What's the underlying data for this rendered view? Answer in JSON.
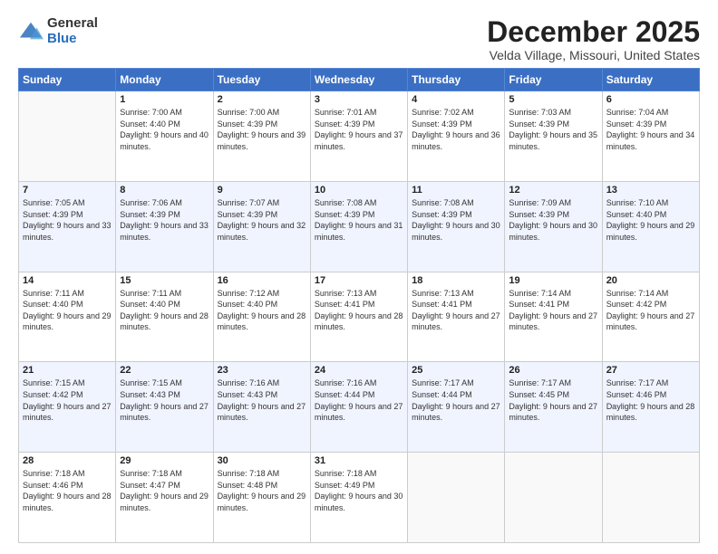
{
  "logo": {
    "general": "General",
    "blue": "Blue"
  },
  "title": "December 2025",
  "subtitle": "Velda Village, Missouri, United States",
  "days_of_week": [
    "Sunday",
    "Monday",
    "Tuesday",
    "Wednesday",
    "Thursday",
    "Friday",
    "Saturday"
  ],
  "weeks": [
    [
      {
        "day": "",
        "sunrise": "",
        "sunset": "",
        "daylight": ""
      },
      {
        "day": "1",
        "sunrise": "Sunrise: 7:00 AM",
        "sunset": "Sunset: 4:40 PM",
        "daylight": "Daylight: 9 hours and 40 minutes."
      },
      {
        "day": "2",
        "sunrise": "Sunrise: 7:00 AM",
        "sunset": "Sunset: 4:39 PM",
        "daylight": "Daylight: 9 hours and 39 minutes."
      },
      {
        "day": "3",
        "sunrise": "Sunrise: 7:01 AM",
        "sunset": "Sunset: 4:39 PM",
        "daylight": "Daylight: 9 hours and 37 minutes."
      },
      {
        "day": "4",
        "sunrise": "Sunrise: 7:02 AM",
        "sunset": "Sunset: 4:39 PM",
        "daylight": "Daylight: 9 hours and 36 minutes."
      },
      {
        "day": "5",
        "sunrise": "Sunrise: 7:03 AM",
        "sunset": "Sunset: 4:39 PM",
        "daylight": "Daylight: 9 hours and 35 minutes."
      },
      {
        "day": "6",
        "sunrise": "Sunrise: 7:04 AM",
        "sunset": "Sunset: 4:39 PM",
        "daylight": "Daylight: 9 hours and 34 minutes."
      }
    ],
    [
      {
        "day": "7",
        "sunrise": "Sunrise: 7:05 AM",
        "sunset": "Sunset: 4:39 PM",
        "daylight": "Daylight: 9 hours and 33 minutes."
      },
      {
        "day": "8",
        "sunrise": "Sunrise: 7:06 AM",
        "sunset": "Sunset: 4:39 PM",
        "daylight": "Daylight: 9 hours and 33 minutes."
      },
      {
        "day": "9",
        "sunrise": "Sunrise: 7:07 AM",
        "sunset": "Sunset: 4:39 PM",
        "daylight": "Daylight: 9 hours and 32 minutes."
      },
      {
        "day": "10",
        "sunrise": "Sunrise: 7:08 AM",
        "sunset": "Sunset: 4:39 PM",
        "daylight": "Daylight: 9 hours and 31 minutes."
      },
      {
        "day": "11",
        "sunrise": "Sunrise: 7:08 AM",
        "sunset": "Sunset: 4:39 PM",
        "daylight": "Daylight: 9 hours and 30 minutes."
      },
      {
        "day": "12",
        "sunrise": "Sunrise: 7:09 AM",
        "sunset": "Sunset: 4:39 PM",
        "daylight": "Daylight: 9 hours and 30 minutes."
      },
      {
        "day": "13",
        "sunrise": "Sunrise: 7:10 AM",
        "sunset": "Sunset: 4:40 PM",
        "daylight": "Daylight: 9 hours and 29 minutes."
      }
    ],
    [
      {
        "day": "14",
        "sunrise": "Sunrise: 7:11 AM",
        "sunset": "Sunset: 4:40 PM",
        "daylight": "Daylight: 9 hours and 29 minutes."
      },
      {
        "day": "15",
        "sunrise": "Sunrise: 7:11 AM",
        "sunset": "Sunset: 4:40 PM",
        "daylight": "Daylight: 9 hours and 28 minutes."
      },
      {
        "day": "16",
        "sunrise": "Sunrise: 7:12 AM",
        "sunset": "Sunset: 4:40 PM",
        "daylight": "Daylight: 9 hours and 28 minutes."
      },
      {
        "day": "17",
        "sunrise": "Sunrise: 7:13 AM",
        "sunset": "Sunset: 4:41 PM",
        "daylight": "Daylight: 9 hours and 28 minutes."
      },
      {
        "day": "18",
        "sunrise": "Sunrise: 7:13 AM",
        "sunset": "Sunset: 4:41 PM",
        "daylight": "Daylight: 9 hours and 27 minutes."
      },
      {
        "day": "19",
        "sunrise": "Sunrise: 7:14 AM",
        "sunset": "Sunset: 4:41 PM",
        "daylight": "Daylight: 9 hours and 27 minutes."
      },
      {
        "day": "20",
        "sunrise": "Sunrise: 7:14 AM",
        "sunset": "Sunset: 4:42 PM",
        "daylight": "Daylight: 9 hours and 27 minutes."
      }
    ],
    [
      {
        "day": "21",
        "sunrise": "Sunrise: 7:15 AM",
        "sunset": "Sunset: 4:42 PM",
        "daylight": "Daylight: 9 hours and 27 minutes."
      },
      {
        "day": "22",
        "sunrise": "Sunrise: 7:15 AM",
        "sunset": "Sunset: 4:43 PM",
        "daylight": "Daylight: 9 hours and 27 minutes."
      },
      {
        "day": "23",
        "sunrise": "Sunrise: 7:16 AM",
        "sunset": "Sunset: 4:43 PM",
        "daylight": "Daylight: 9 hours and 27 minutes."
      },
      {
        "day": "24",
        "sunrise": "Sunrise: 7:16 AM",
        "sunset": "Sunset: 4:44 PM",
        "daylight": "Daylight: 9 hours and 27 minutes."
      },
      {
        "day": "25",
        "sunrise": "Sunrise: 7:17 AM",
        "sunset": "Sunset: 4:44 PM",
        "daylight": "Daylight: 9 hours and 27 minutes."
      },
      {
        "day": "26",
        "sunrise": "Sunrise: 7:17 AM",
        "sunset": "Sunset: 4:45 PM",
        "daylight": "Daylight: 9 hours and 27 minutes."
      },
      {
        "day": "27",
        "sunrise": "Sunrise: 7:17 AM",
        "sunset": "Sunset: 4:46 PM",
        "daylight": "Daylight: 9 hours and 28 minutes."
      }
    ],
    [
      {
        "day": "28",
        "sunrise": "Sunrise: 7:18 AM",
        "sunset": "Sunset: 4:46 PM",
        "daylight": "Daylight: 9 hours and 28 minutes."
      },
      {
        "day": "29",
        "sunrise": "Sunrise: 7:18 AM",
        "sunset": "Sunset: 4:47 PM",
        "daylight": "Daylight: 9 hours and 29 minutes."
      },
      {
        "day": "30",
        "sunrise": "Sunrise: 7:18 AM",
        "sunset": "Sunset: 4:48 PM",
        "daylight": "Daylight: 9 hours and 29 minutes."
      },
      {
        "day": "31",
        "sunrise": "Sunrise: 7:18 AM",
        "sunset": "Sunset: 4:49 PM",
        "daylight": "Daylight: 9 hours and 30 minutes."
      },
      {
        "day": "",
        "sunrise": "",
        "sunset": "",
        "daylight": ""
      },
      {
        "day": "",
        "sunrise": "",
        "sunset": "",
        "daylight": ""
      },
      {
        "day": "",
        "sunrise": "",
        "sunset": "",
        "daylight": ""
      }
    ]
  ]
}
